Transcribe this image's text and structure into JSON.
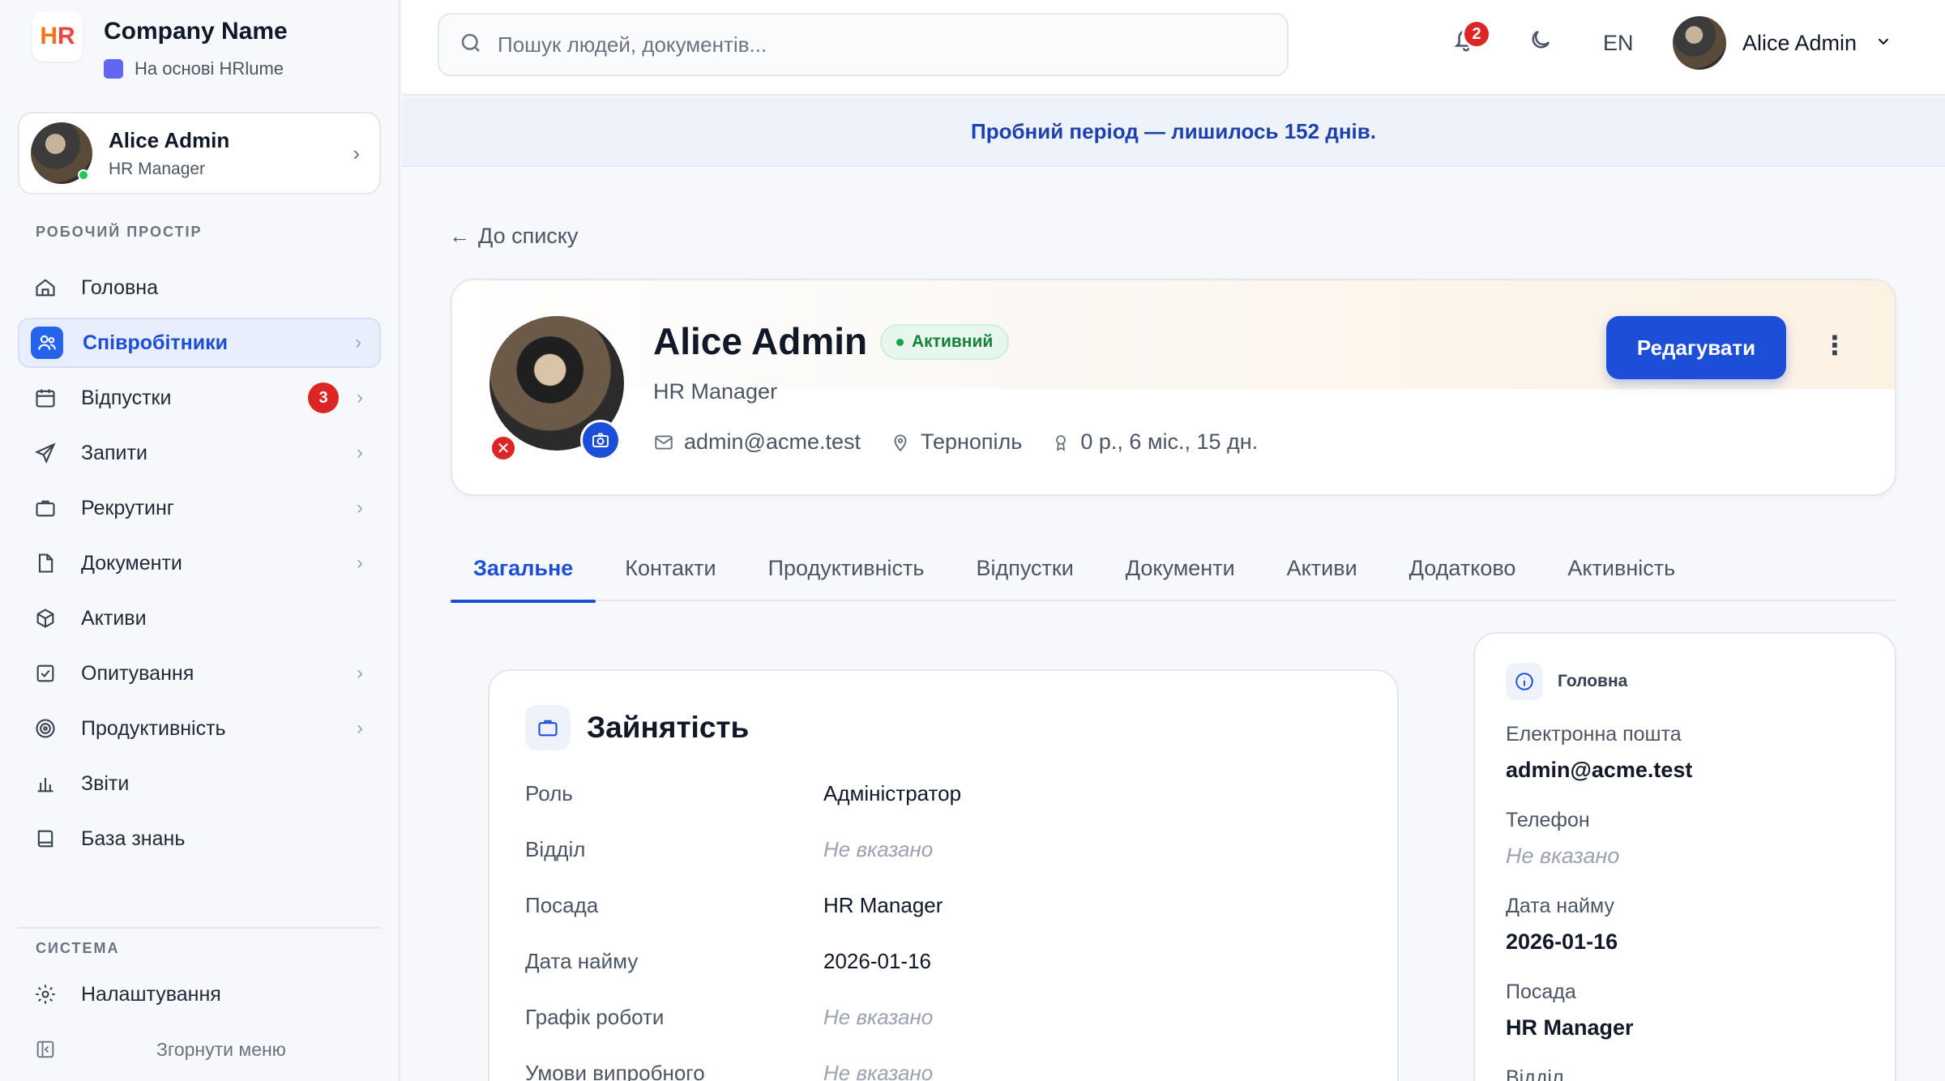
{
  "brand": {
    "logo_text": "HR",
    "name": "Company Name",
    "powered_by": "На основі HRlume"
  },
  "sidebar": {
    "user": {
      "name": "Alice Admin",
      "role": "HR Manager"
    },
    "workspace_title": "РОБОЧИЙ ПРОСТІР",
    "items": [
      {
        "label": "Головна",
        "icon": "home-icon"
      },
      {
        "label": "Співробітники",
        "icon": "users-icon",
        "active": true
      },
      {
        "label": "Відпустки",
        "icon": "calendar-icon",
        "badge": "3"
      },
      {
        "label": "Запити",
        "icon": "send-icon"
      },
      {
        "label": "Рекрутинг",
        "icon": "briefcase-icon"
      },
      {
        "label": "Документи",
        "icon": "file-icon"
      },
      {
        "label": "Активи",
        "icon": "box-icon"
      },
      {
        "label": "Опитування",
        "icon": "check-square-icon"
      },
      {
        "label": "Продуктивність",
        "icon": "target-icon"
      },
      {
        "label": "Звіти",
        "icon": "bar-chart-icon"
      },
      {
        "label": "База знань",
        "icon": "book-icon"
      }
    ],
    "system_title": "СИСТЕМА",
    "settings_label": "Налаштування",
    "collapse_label": "Згорнути меню"
  },
  "topbar": {
    "search_placeholder": "Пошук людей, документів...",
    "notifications_count": "2",
    "language": "EN",
    "user_name": "Alice Admin"
  },
  "trial_banner": "Пробний період — лишилось 152 днів.",
  "back_label": "До списку",
  "profile": {
    "name": "Alice Admin",
    "status": "Активний",
    "role": "HR Manager",
    "email": "admin@acme.test",
    "city": "Тернопіль",
    "tenure": "0 р., 6 міс., 15 дн.",
    "edit_label": "Редагувати"
  },
  "tabs": [
    "Загальне",
    "Контакти",
    "Продуктивність",
    "Відпустки",
    "Документи",
    "Активи",
    "Додатково",
    "Активність"
  ],
  "employment": {
    "title": "Зайнятість",
    "rows": [
      {
        "key": "Роль",
        "value": "Адміністратор"
      },
      {
        "key": "Відділ",
        "value": "Не вказано",
        "empty": true
      },
      {
        "key": "Посада",
        "value": "HR Manager"
      },
      {
        "key": "Дата найму",
        "value": "2026-01-16"
      },
      {
        "key": "Графік роботи",
        "value": "Не вказано",
        "empty": true
      },
      {
        "key": "Умови випробного",
        "value": "Не вказано",
        "empty": true
      }
    ]
  },
  "main_info": {
    "title": "Головна",
    "fields": [
      {
        "key": "Електронна пошта",
        "value": "admin@acme.test"
      },
      {
        "key": "Телефон",
        "value": "Не вказано",
        "empty": true
      },
      {
        "key": "Дата найму",
        "value": "2026-01-16"
      },
      {
        "key": "Посада",
        "value": "HR Manager"
      },
      {
        "key": "Відділ",
        "value": ""
      }
    ]
  },
  "colors": {
    "accent": "#1d4ed8",
    "danger": "#dc2626",
    "success": "#16a34a"
  }
}
